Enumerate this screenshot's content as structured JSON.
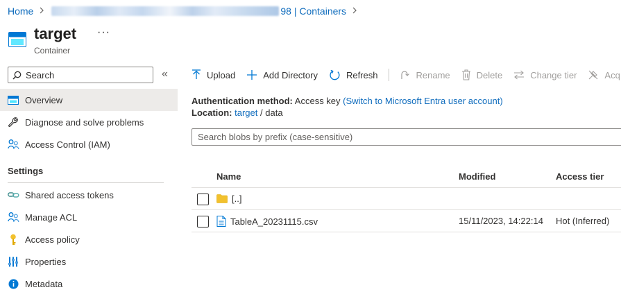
{
  "breadcrumb": {
    "home": "Home",
    "current": "98 | Containers"
  },
  "header": {
    "title": "target",
    "subtitle": "Container",
    "more": "···"
  },
  "sidebar": {
    "search_placeholder": "Search",
    "collapse": "«",
    "items": [
      {
        "label": "Overview",
        "icon": "container-icon",
        "selected": true
      },
      {
        "label": "Diagnose and solve problems",
        "icon": "wrench-icon"
      },
      {
        "label": "Access Control (IAM)",
        "icon": "people-icon"
      }
    ],
    "settings_title": "Settings",
    "settings_items": [
      {
        "label": "Shared access tokens",
        "icon": "link-icon"
      },
      {
        "label": "Manage ACL",
        "icon": "people-icon"
      },
      {
        "label": "Access policy",
        "icon": "key-icon"
      },
      {
        "label": "Properties",
        "icon": "sliders-icon"
      },
      {
        "label": "Metadata",
        "icon": "info-icon"
      }
    ]
  },
  "toolbar": {
    "upload": "Upload",
    "add_directory": "Add Directory",
    "refresh": "Refresh",
    "rename": "Rename",
    "delete": "Delete",
    "change_tier": "Change tier",
    "acquire": "Acq"
  },
  "info": {
    "auth_label": "Authentication method:",
    "auth_value": "Access key",
    "auth_link": "(Switch to Microsoft Entra user account)",
    "location_label": "Location:",
    "location_link": "target",
    "location_sep": "/",
    "location_path": "data"
  },
  "blob_search": {
    "placeholder": "Search blobs by prefix (case-sensitive)"
  },
  "table": {
    "columns": [
      "Name",
      "Modified",
      "Access tier"
    ],
    "rows": [
      {
        "name": "[..]",
        "type": "folder",
        "modified": "",
        "tier": ""
      },
      {
        "name": "TableA_20231115.csv",
        "type": "file",
        "modified": "15/11/2023, 14:22:14",
        "tier": "Hot (Inferred)"
      }
    ]
  },
  "colors": {
    "accent": "#0f6cbd",
    "folder": "#f2c12e",
    "selected_bg": "#edebe9"
  }
}
